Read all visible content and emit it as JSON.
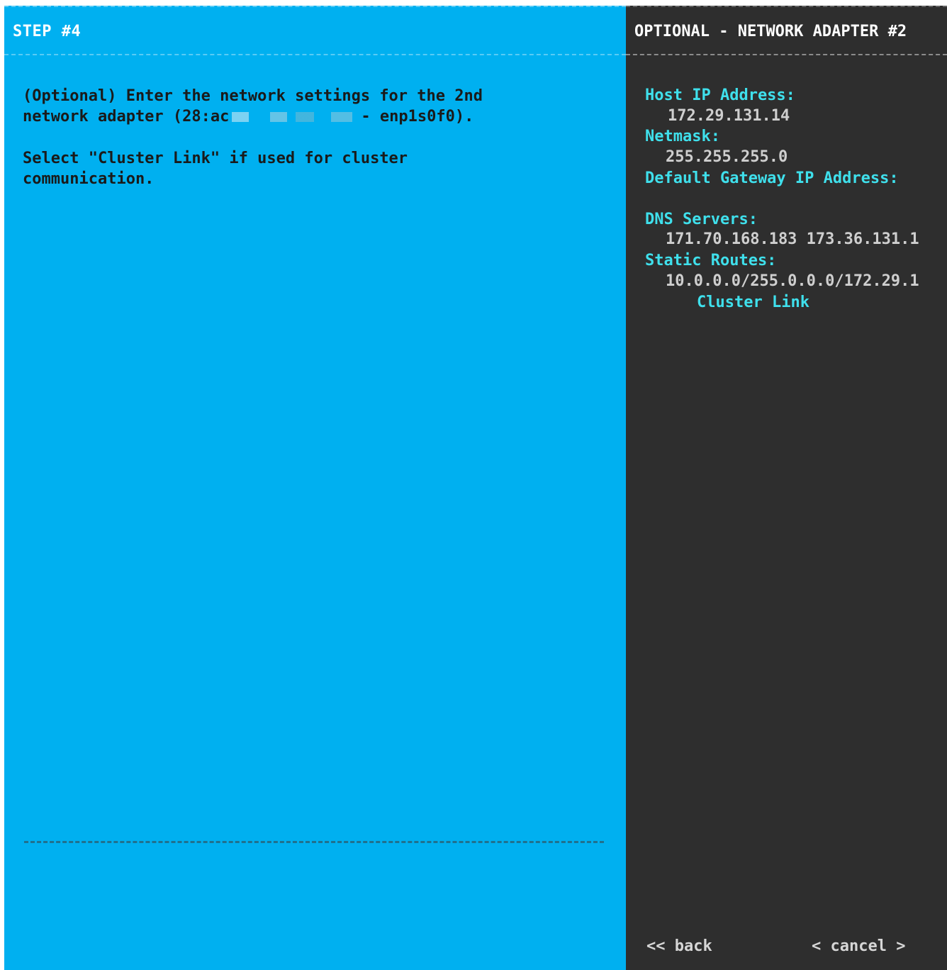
{
  "step_panel": {
    "title": "STEP #4",
    "line1": "(Optional) Enter the network settings for the 2nd",
    "line2_prefix": "network adapter (28:ac",
    "line2_suffix": "- enp1s0f0).",
    "line3": "Select \"Cluster Link\" if used for cluster",
    "line4": "communication.",
    "background_color": "#00b0f0"
  },
  "adapter_panel": {
    "title": "OPTIONAL - NETWORK ADAPTER #2",
    "host_ip_label": "Host IP Address:",
    "host_ip_value": "172.29.131.14",
    "netmask_label": "Netmask:",
    "netmask_value": "255.255.255.0",
    "gateway_label": "Default Gateway IP Address:",
    "gateway_value": "",
    "dns_label": "DNS Servers:",
    "dns_value": "171.70.168.183 173.36.131.1",
    "routes_label": "Static Routes:",
    "routes_value": "10.0.0.0/255.0.0.0/172.29.1",
    "cluster_link_label": "Cluster Link",
    "label_color": "#3fe0ec",
    "background_color": "#2e2e2e"
  },
  "navigation": {
    "back_label": "<< back",
    "cancel_label": "< cancel >"
  }
}
